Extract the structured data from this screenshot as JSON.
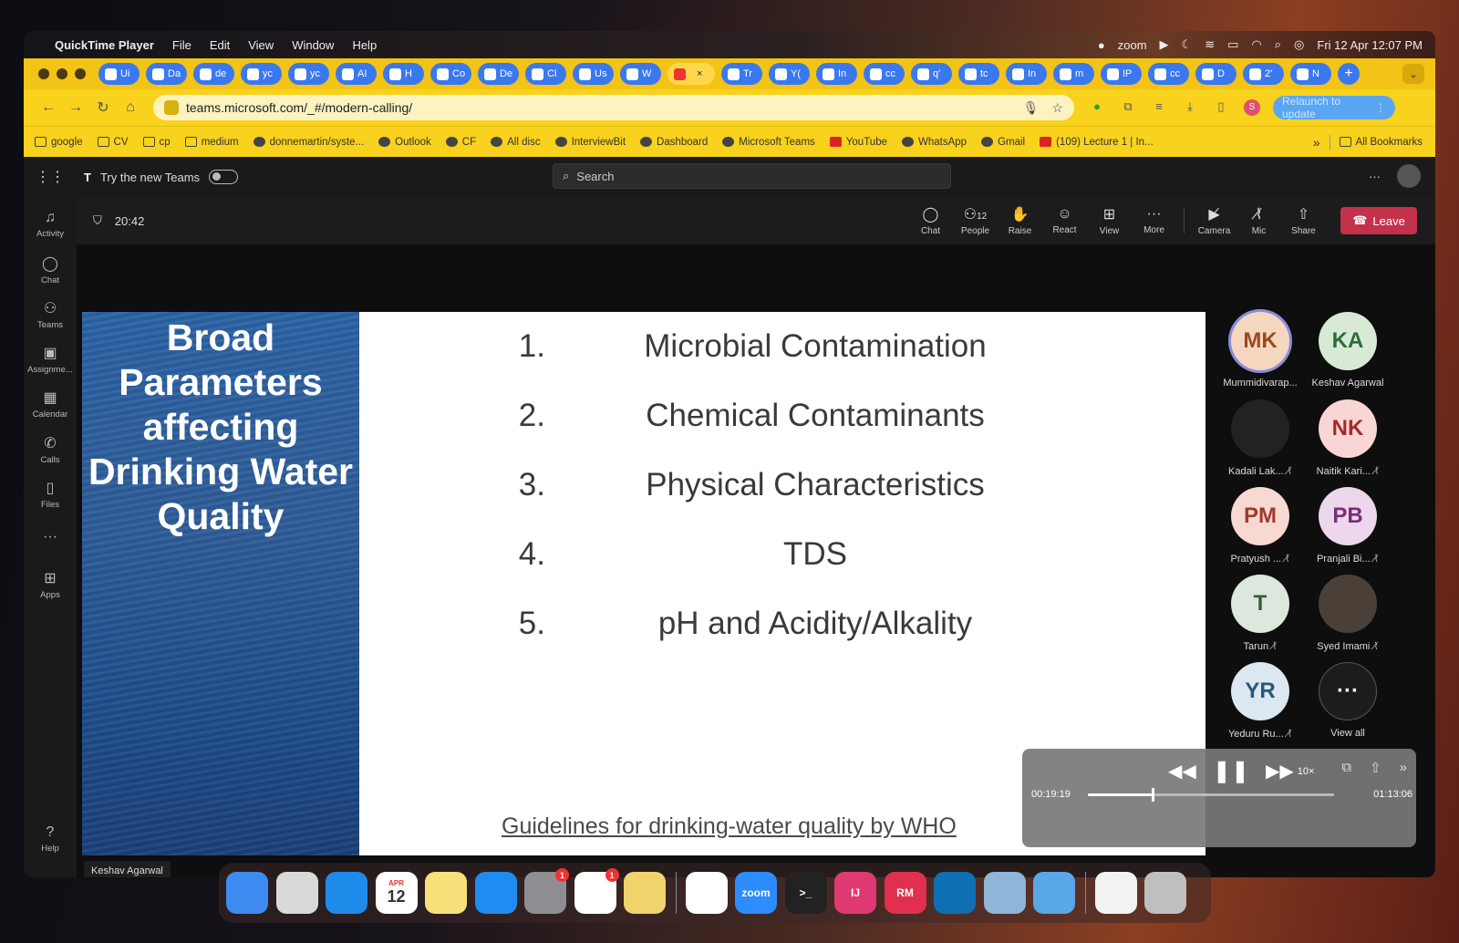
{
  "menubar": {
    "app": "QuickTime Player",
    "menus": [
      "File",
      "Edit",
      "View",
      "Window",
      "Help"
    ],
    "status": {
      "zoom": "zoom",
      "datetime": "Fri 12 Apr  12:07 PM"
    }
  },
  "browser": {
    "tabs": [
      {
        "label": "Ui"
      },
      {
        "label": "Da"
      },
      {
        "label": "de"
      },
      {
        "label": "yc"
      },
      {
        "label": "yc"
      },
      {
        "label": "AI"
      },
      {
        "label": "H"
      },
      {
        "label": "Co"
      },
      {
        "label": "De"
      },
      {
        "label": "Cl"
      },
      {
        "label": "Us"
      },
      {
        "label": "W"
      },
      {
        "label": "",
        "active": true
      },
      {
        "label": "Tr"
      },
      {
        "label": "Y("
      },
      {
        "label": "In"
      },
      {
        "label": "cc"
      },
      {
        "label": "q'"
      },
      {
        "label": "tc"
      },
      {
        "label": "In"
      },
      {
        "label": "m"
      },
      {
        "label": "IP"
      },
      {
        "label": "cc"
      },
      {
        "label": "D"
      },
      {
        "label": "2'"
      },
      {
        "label": "N"
      }
    ],
    "url": "teams.microsoft.com/_#/modern-calling/",
    "relaunch": "Relaunch to update",
    "profile_initial": "S",
    "bookmarks": [
      {
        "label": "google",
        "icon": "folder-icon"
      },
      {
        "label": "CV",
        "icon": "folder-icon"
      },
      {
        "label": "cp",
        "icon": "folder-icon"
      },
      {
        "label": "medium",
        "icon": "folder-icon"
      },
      {
        "label": "donnemartin/syste...",
        "icon": "github-icon"
      },
      {
        "label": "Outlook",
        "icon": "outlook-icon"
      },
      {
        "label": "CF",
        "icon": "codeforces-icon"
      },
      {
        "label": "All disc",
        "icon": "leetcode-icon"
      },
      {
        "label": "InterviewBit",
        "icon": "interviewbit-icon"
      },
      {
        "label": "Dashboard",
        "icon": "dashboard-icon"
      },
      {
        "label": "Microsoft Teams",
        "icon": "teams-icon"
      },
      {
        "label": "YouTube",
        "icon": "youtube-icon"
      },
      {
        "label": "WhatsApp",
        "icon": "whatsapp-icon"
      },
      {
        "label": "Gmail",
        "icon": "gmail-icon"
      },
      {
        "label": "(109) Lecture 1 | In...",
        "icon": "youtube-icon"
      }
    ],
    "more": "»",
    "all_bookmarks": "All Bookmarks"
  },
  "teams": {
    "try_new": "Try the new Teams",
    "search_placeholder": "Search",
    "rail": [
      "Activity",
      "Chat",
      "Teams",
      "Assignme...",
      "Calendar",
      "Calls",
      "Files",
      "Apps",
      "Help"
    ],
    "meeting": {
      "timer": "20:42",
      "controls": [
        {
          "label": "Chat"
        },
        {
          "label": "People",
          "count": "12"
        },
        {
          "label": "Raise"
        },
        {
          "label": "React"
        },
        {
          "label": "View"
        },
        {
          "label": "More"
        },
        {
          "label": "Camera"
        },
        {
          "label": "Mic"
        },
        {
          "label": "Share"
        }
      ],
      "leave": "Leave",
      "presenter": "Keshav Agarwal",
      "slide": {
        "title": "Broad Parameters affecting Drinking Water Quality",
        "items": [
          {
            "num": "1.",
            "text": "Microbial Contamination"
          },
          {
            "num": "2.",
            "text": "Chemical Contaminants"
          },
          {
            "num": "3.",
            "text": "Physical Characteristics"
          },
          {
            "num": "4.",
            "text": "TDS"
          },
          {
            "num": "5.",
            "text": "pH and Acidity/Alkality"
          }
        ],
        "footer": "Guidelines for drinking-water quality by WHO"
      },
      "participants": [
        {
          "initials": "MK",
          "name": "Mummidivarap...",
          "muted": false,
          "bg": "#f5d7c0",
          "fg": "#9a4a1c",
          "speaking": true
        },
        {
          "initials": "KA",
          "name": "Keshav Agarwal",
          "muted": false,
          "bg": "#d8ead6",
          "fg": "#2f6b3a"
        },
        {
          "initials": "",
          "name": "Kadali Lak...",
          "muted": true,
          "bg": "#222",
          "fg": "#fff"
        },
        {
          "initials": "NK",
          "name": "Naitik Kari...",
          "muted": true,
          "bg": "#f9d6d6",
          "fg": "#a32a2a"
        },
        {
          "initials": "PM",
          "name": "Pratyush ...",
          "muted": true,
          "bg": "#f7d9d2",
          "fg": "#a03a2a"
        },
        {
          "initials": "PB",
          "name": "Pranjali Bi...",
          "muted": true,
          "bg": "#ecd7ec",
          "fg": "#7a2d7a"
        },
        {
          "initials": "T",
          "name": "Tarun",
          "muted": true,
          "bg": "#dde7dd",
          "fg": "#3b5a3b"
        },
        {
          "initials": "",
          "name": "Syed Imami",
          "muted": true,
          "bg": "#4a4038",
          "fg": "#fff"
        },
        {
          "initials": "YR",
          "name": "Yeduru Ru...",
          "muted": true,
          "bg": "#dbe7f1",
          "fg": "#2c5675"
        },
        {
          "initials": "···",
          "name": "View all",
          "muted": false,
          "bg": "#1c1c1c",
          "fg": "#fff"
        }
      ]
    }
  },
  "quicktime": {
    "elapsed": "00:19:19",
    "remaining": "01:13:06",
    "speed": "10×",
    "progress": 0.26
  },
  "dock": [
    {
      "name": "finder-icon",
      "color": "#3d8bf0",
      "label": ""
    },
    {
      "name": "launchpad-icon",
      "color": "#d9d9d9",
      "label": ""
    },
    {
      "name": "safari-icon",
      "color": "#1e8bea",
      "label": ""
    },
    {
      "name": "calendar-icon",
      "color": "#ffffff",
      "label": "12",
      "month": "APR"
    },
    {
      "name": "notes-icon",
      "color": "#f8e07a",
      "label": ""
    },
    {
      "name": "app-store-icon",
      "color": "#1e8cf0",
      "label": ""
    },
    {
      "name": "system-settings-icon",
      "color": "#8e8e93",
      "label": "",
      "badge": "1"
    },
    {
      "name": "slack-icon",
      "color": "#ffffff",
      "label": "",
      "badge": "1"
    },
    {
      "name": "stickies-icon",
      "color": "#f1d36b",
      "label": ""
    },
    {
      "name": "chrome-icon",
      "color": "#ffffff",
      "label": ""
    },
    {
      "name": "zoom-icon",
      "color": "#2d8cff",
      "label": "zoom"
    },
    {
      "name": "terminal-icon",
      "color": "#222",
      "label": ">_"
    },
    {
      "name": "intellij-icon",
      "color": "#e03a73",
      "label": "IJ"
    },
    {
      "name": "rubymine-icon",
      "color": "#e0304e",
      "label": "RM"
    },
    {
      "name": "vscode-icon",
      "color": "#0f6fb3",
      "label": ""
    },
    {
      "name": "preview-icon",
      "color": "#8fb5d9",
      "label": ""
    },
    {
      "name": "quicktime-icon",
      "color": "#5aa7e8",
      "label": ""
    },
    {
      "name": "document-icon",
      "color": "#f2f2f2",
      "label": ""
    },
    {
      "name": "trash-icon",
      "color": "#bfbfbf",
      "label": ""
    }
  ]
}
